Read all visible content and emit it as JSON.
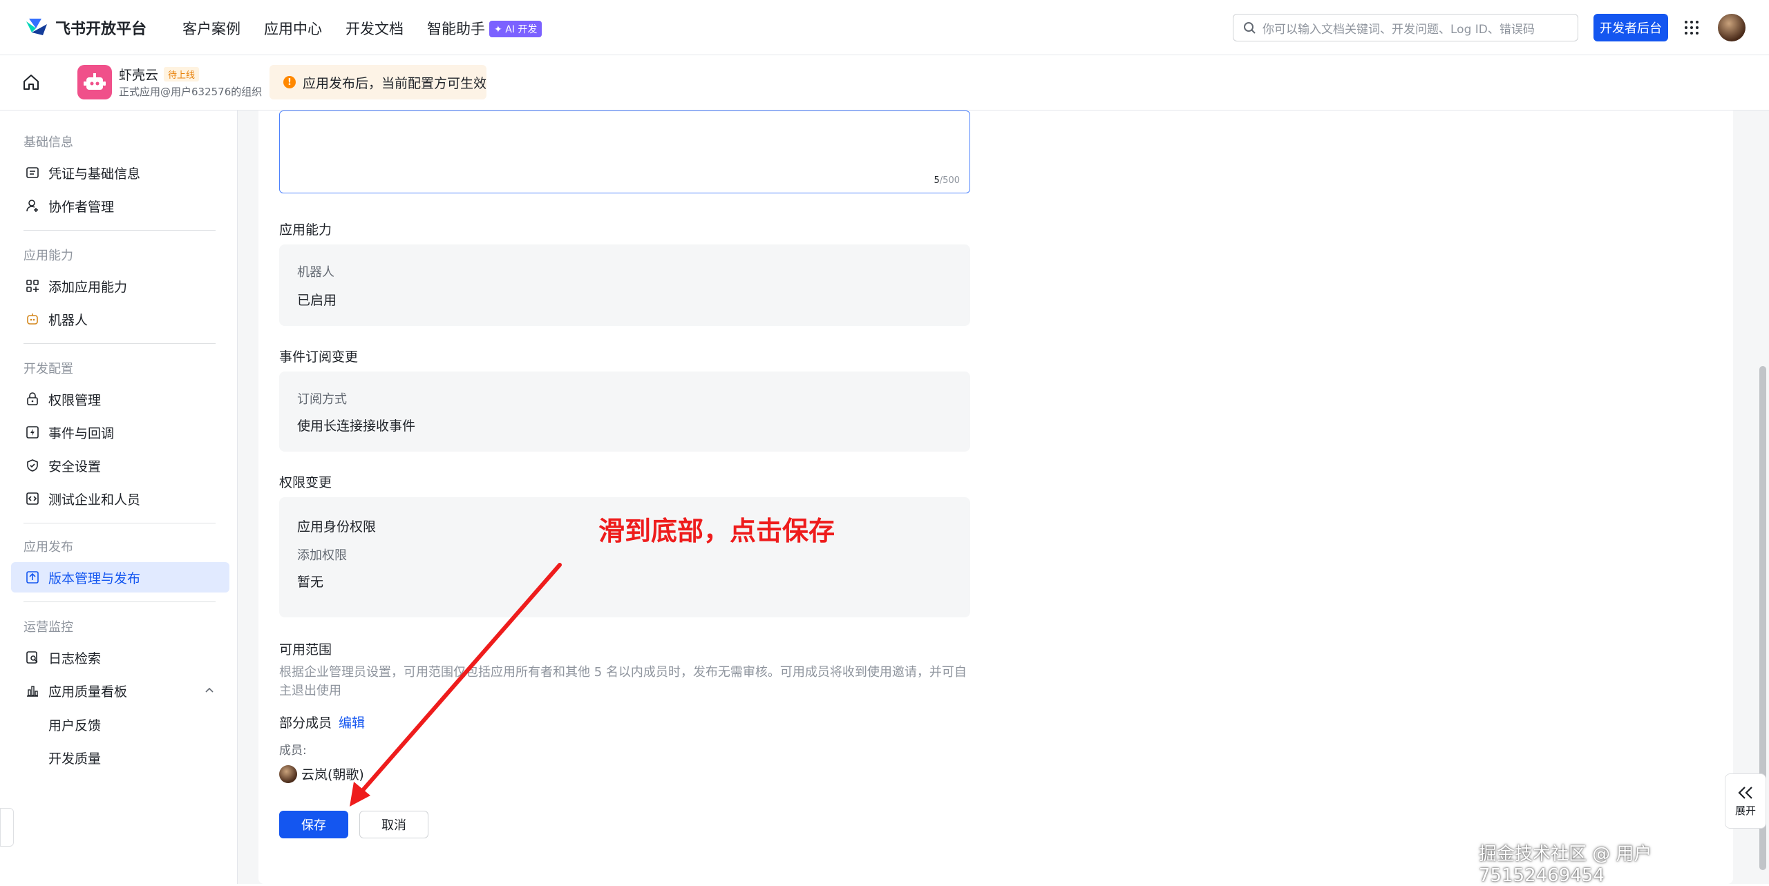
{
  "header": {
    "logo_text": "飞书开放平台",
    "nav": [
      "客户案例",
      "应用中心",
      "开发文档",
      "智能助手"
    ],
    "ai_badge": "AI 开发",
    "search_placeholder": "你可以输入文档关键词、开发问题、Log ID、错误码",
    "dev_console_label": "开发者后台"
  },
  "app_bar": {
    "app_name": "虾壳云",
    "status_tag": "待上线",
    "app_sub": "正式应用@用户632576的组织",
    "notice": "应用发布后，当前配置方可生效"
  },
  "sidebar": {
    "sections": [
      {
        "title": "基础信息",
        "items": [
          "凭证与基础信息",
          "协作者管理"
        ]
      },
      {
        "title": "应用能力",
        "items": [
          "添加应用能力",
          "机器人"
        ]
      },
      {
        "title": "开发配置",
        "items": [
          "权限管理",
          "事件与回调",
          "安全设置",
          "测试企业和人员"
        ]
      },
      {
        "title": "应用发布",
        "items": [
          "版本管理与发布"
        ]
      },
      {
        "title": "运营监控",
        "items": [
          "日志检索",
          "应用质量看板"
        ],
        "sub_items": [
          "用户反馈",
          "开发质量"
        ]
      }
    ],
    "active_item": "版本管理与发布"
  },
  "form": {
    "textarea_counter_current": "5",
    "textarea_counter_max": "/500",
    "ability_label": "应用能力",
    "ability_key": "机器人",
    "ability_value": "已启用",
    "event_label": "事件订阅变更",
    "event_key": "订阅方式",
    "event_value": "使用长连接接收事件",
    "perm_label": "权限变更",
    "perm_identity": "应用身份权限",
    "perm_add_key": "添加权限",
    "perm_add_value": "暂无",
    "scope_label": "可用范围",
    "scope_desc": "根据企业管理员设置，可用范围仅包括应用所有者和其他 5 名以内成员时，发布无需审核。可用成员将收到使用邀请，并可自主退出使用",
    "scope_partial": "部分成员",
    "scope_edit": "编辑",
    "members_label": "成员:",
    "member_name": "云岚(朝歌)",
    "save_label": "保存",
    "cancel_label": "取消"
  },
  "annotation_text": "滑到底部，点击保存",
  "expand_label": "展开",
  "watermark": "掘金技术社区 @ 用户75152469454",
  "colors": {
    "primary": "#1456f0",
    "annotation": "#ee1c1c",
    "app_icon": "#f0508a"
  }
}
